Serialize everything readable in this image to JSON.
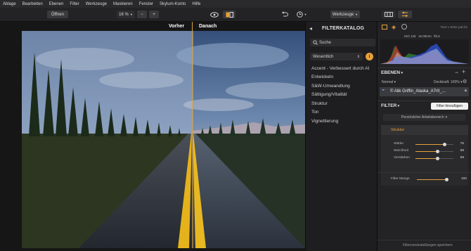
{
  "menu": [
    "Ablage",
    "Bearbeiten",
    "Ebenen",
    "Filter",
    "Werkzeuge",
    "Maskieren",
    "Fenster",
    "Skylum-Konto",
    "Hilfe"
  ],
  "toolbar": {
    "open_label": "Öffnen",
    "zoom": "16 %",
    "zoom_out": "−",
    "zoom_in": "+",
    "tools_label": "Werkzeuge"
  },
  "canvas": {
    "before_label": "Vorher",
    "after_label": "Danach"
  },
  "catalog": {
    "title": "FILTERKATALOG",
    "search_placeholder": "Suche",
    "category": "Wesentlich",
    "items": [
      "Accent - Verbessert durch AI",
      "Entwickeln",
      "S&W-Umwandlung",
      "Sättigung/Vitalität",
      "Struktur",
      "Ton",
      "Vignettierung"
    ]
  },
  "info": {
    "dimensions": "7622 x 5084 px",
    "bit": "8-bit",
    "iso": "ISO 125",
    "focal": "16.00mm",
    "aperture": "f/5.6"
  },
  "layers": {
    "title": "EBENEN",
    "blend": "Normal",
    "opacity_label": "Deckkraft: 100%",
    "layer_name": "© Alik Griffin_Alaska_A7rII_..."
  },
  "filter": {
    "title": "FILTER",
    "add_label": "Filter hinzufügen",
    "workspace": "Persönlicher Arbeitsbereich",
    "structure_title": "Struktur",
    "sliders": [
      {
        "label": "Stärke",
        "value": 76
      },
      {
        "label": "Weichheit",
        "value": 58
      },
      {
        "label": "Verstärken",
        "value": 58
      }
    ],
    "amount": {
      "label": "Filter Menge",
      "value": 100
    }
  },
  "footer": {
    "save_label": "Filtervoreinstellungen speichern"
  }
}
